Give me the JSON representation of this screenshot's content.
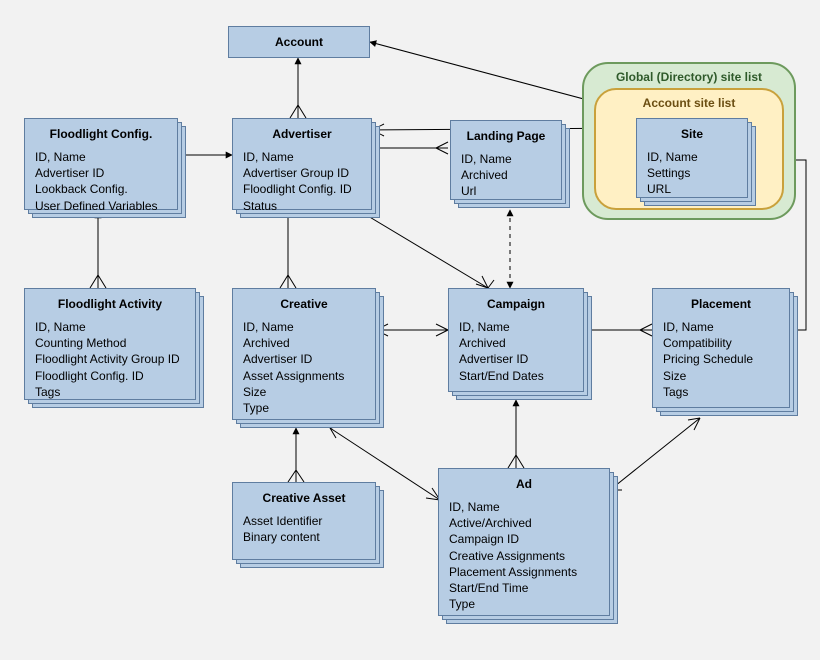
{
  "global_list_label": "Global (Directory) site list",
  "account_list_label": "Account site list",
  "entities": {
    "account": {
      "title": "Account",
      "attrs": []
    },
    "floodlight_config": {
      "title": "Floodlight Config.",
      "attrs": [
        "ID, Name",
        "Advertiser ID",
        "Lookback Config.",
        "User Defined Variables"
      ]
    },
    "advertiser": {
      "title": "Advertiser",
      "attrs": [
        "ID, Name",
        "Advertiser Group ID",
        "Floodlight Config. ID",
        "Status"
      ]
    },
    "landing_page": {
      "title": "Landing Page",
      "attrs": [
        "ID, Name",
        "Archived",
        "Url"
      ]
    },
    "site": {
      "title": "Site",
      "attrs": [
        "ID, Name",
        "Settings",
        "URL"
      ]
    },
    "floodlight_activity": {
      "title": "Floodlight Activity",
      "attrs": [
        "ID, Name",
        "Counting Method",
        "Floodlight Activity Group ID",
        "Floodlight Config. ID",
        "Tags"
      ]
    },
    "creative": {
      "title": "Creative",
      "attrs": [
        "ID, Name",
        "Archived",
        "Advertiser ID",
        "Asset Assignments",
        "Size",
        "Type"
      ]
    },
    "campaign": {
      "title": "Campaign",
      "attrs": [
        "ID, Name",
        "Archived",
        "Advertiser ID",
        "Start/End Dates"
      ]
    },
    "placement": {
      "title": "Placement",
      "attrs": [
        "ID, Name",
        "Compatibility",
        "Pricing Schedule",
        "Size",
        "Tags"
      ]
    },
    "creative_asset": {
      "title": "Creative Asset",
      "attrs": [
        "Asset Identifier",
        "Binary content"
      ]
    },
    "ad": {
      "title": "Ad",
      "attrs": [
        "ID, Name",
        "Active/Archived",
        "Campaign ID",
        "Creative Assignments",
        "Placement Assignments",
        "Start/End Time",
        "Type"
      ]
    }
  },
  "relationships": [
    {
      "from": "account",
      "to": "advertiser",
      "type": "one-to-many"
    },
    {
      "from": "account",
      "to": "site",
      "type": "one-to-many"
    },
    {
      "from": "advertiser",
      "to": "floodlight_config",
      "type": "one-to-one"
    },
    {
      "from": "advertiser",
      "to": "site",
      "type": "many-to-many"
    },
    {
      "from": "advertiser",
      "to": "landing_page",
      "type": "one-to-many"
    },
    {
      "from": "advertiser",
      "to": "creative",
      "type": "one-to-many"
    },
    {
      "from": "advertiser",
      "to": "campaign",
      "type": "one-to-many"
    },
    {
      "from": "floodlight_config",
      "to": "floodlight_activity",
      "type": "one-to-many"
    },
    {
      "from": "campaign",
      "to": "landing_page",
      "type": "one-to-one",
      "style": "dashed"
    },
    {
      "from": "campaign",
      "to": "creative",
      "type": "many-to-many"
    },
    {
      "from": "campaign",
      "to": "placement",
      "type": "one-to-many"
    },
    {
      "from": "campaign",
      "to": "ad",
      "type": "one-to-many"
    },
    {
      "from": "creative",
      "to": "creative_asset",
      "type": "one-to-many"
    },
    {
      "from": "ad",
      "to": "creative",
      "type": "many-to-many"
    },
    {
      "from": "ad",
      "to": "placement",
      "type": "many-to-many"
    },
    {
      "from": "placement",
      "to": "site",
      "type": "many-to-one"
    }
  ]
}
